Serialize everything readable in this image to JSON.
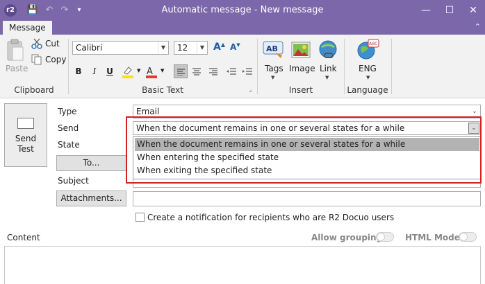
{
  "window": {
    "title": "Automatic message - New message",
    "app_badge": "r2",
    "minimize": "—",
    "maximize": "☐",
    "close": "✕"
  },
  "quick_access": {
    "save": "💾",
    "undo": "↶",
    "redo": "↷",
    "customize": "▾"
  },
  "tabs": [
    {
      "label": "Message",
      "active": true
    }
  ],
  "ribbon": {
    "collapse_glyph": "⌃",
    "clipboard": {
      "label": "Clipboard",
      "paste": "Paste",
      "cut": "Cut",
      "copy": "Copy"
    },
    "basic_text": {
      "label": "Basic Text",
      "font_family": "Calibri",
      "font_size": "12",
      "grow_font": "A",
      "shrink_font": "A",
      "bold": "B",
      "italic": "I",
      "underline": "U",
      "font_color": "A",
      "bullets": "☰",
      "launcher": "⌟"
    },
    "insert": {
      "label": "Insert",
      "tags": "Tags",
      "image": "Image",
      "link": "Link",
      "tags_icon_text": "AB"
    },
    "language": {
      "label": "Language",
      "current": "ENG",
      "icon_text": "ABC"
    }
  },
  "send_test": {
    "label": "Send\nTest"
  },
  "form": {
    "type_label": "Type",
    "type_value": "Email",
    "send_label": "Send",
    "send_value": "When the document remains in one or several states for a while",
    "state_label": "State",
    "to_button": "To...",
    "subject_label": "Subject",
    "attachments_button": "Attachments...",
    "notify_checkbox_label": "Create a notification for recipients who are R2 Docuo users",
    "notify_checked": false
  },
  "send_dropdown": {
    "options": [
      {
        "label": "When the document remains in one or several states for a while",
        "selected": true
      },
      {
        "label": "When entering the specified state",
        "selected": false
      },
      {
        "label": "When exiting the specified state",
        "selected": false
      }
    ]
  },
  "content": {
    "label": "Content",
    "allow_grouping_label": "Allow grouping",
    "allow_grouping_on": false,
    "html_mode_label": "HTML Mode",
    "html_mode_on": false
  },
  "colors": {
    "titlebar": "#7b67a9",
    "ribbon_bg": "#f2f2f2",
    "highlight_frame": "#d42020",
    "dropdown_selected": "#b3b3b3",
    "font_color_underline": "#e53935",
    "highlight_color_underline": "#f7e600"
  }
}
